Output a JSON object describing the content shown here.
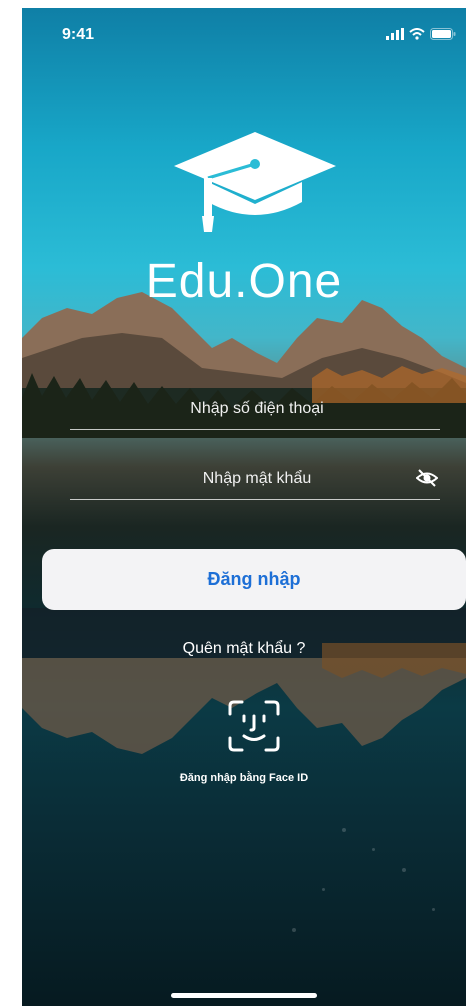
{
  "status_bar": {
    "time": "9:41"
  },
  "app": {
    "brand": "Edu.One"
  },
  "login": {
    "phone_placeholder": "Nhập số điện thoại",
    "password_placeholder": "Nhập mật khẩu",
    "login_button": "Đăng nhập",
    "forgot_password": "Quên mật khẩu ?",
    "faceid_label": "Đăng nhập bằng Face ID"
  },
  "icons": [
    "signal-icon",
    "wifi-icon",
    "battery-icon",
    "graduation-cap-icon",
    "eye-off-icon",
    "faceid-icon"
  ],
  "colors": {
    "button_text": "#1d6fd6",
    "button_bg": "#f3f3f5",
    "sky": "#2bbcd6"
  }
}
